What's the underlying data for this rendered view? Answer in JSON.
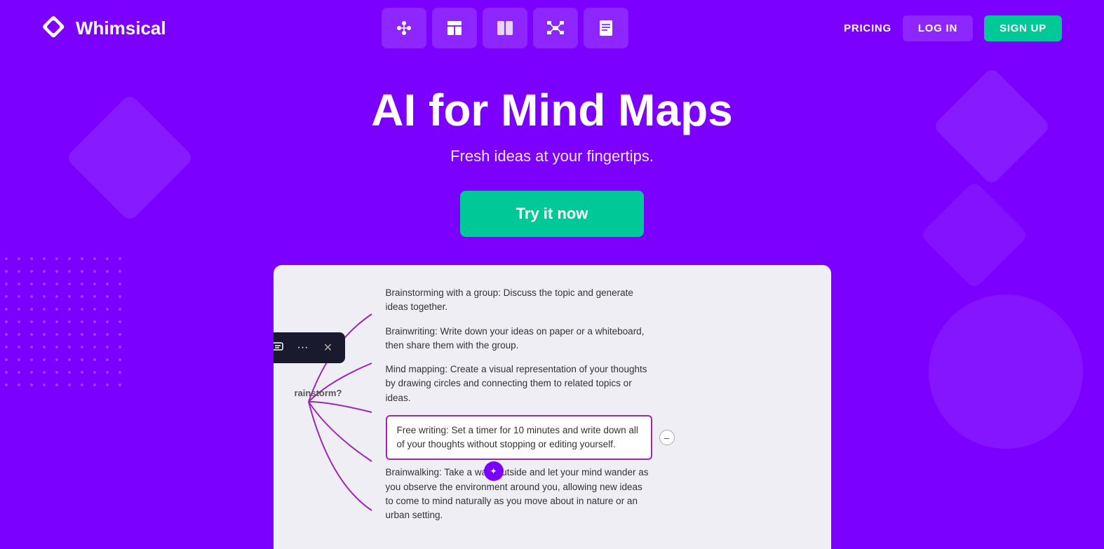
{
  "logo": {
    "text": "Whimsical"
  },
  "nav": {
    "tools": [
      {
        "id": "flowchart",
        "label": "Flowchart"
      },
      {
        "id": "wireframe",
        "label": "Wireframe"
      },
      {
        "id": "split",
        "label": "Split"
      },
      {
        "id": "mindmap",
        "label": "Mind Map"
      },
      {
        "id": "docs",
        "label": "Docs"
      }
    ],
    "pricing": "PRICING",
    "login": "LOG IN",
    "signup": "SIGN UP"
  },
  "hero": {
    "title": "AI for Mind Maps",
    "subtitle": "Fresh ideas at your fingertips.",
    "cta": "Try it now"
  },
  "preview": {
    "root_label": "rainstorm?",
    "nodes": [
      {
        "text": "Brainstorming with a group: Discuss the topic and generate ideas together.",
        "selected": false
      },
      {
        "text": "Brainwriting: Write down your ideas on paper or a whiteboard, then share them with the group.",
        "selected": false
      },
      {
        "text": "Mind mapping: Create a visual representation of your thoughts by drawing circles and connecting them to related topics or ideas.",
        "selected": false
      },
      {
        "text": "Free writing: Set a timer for 10 minutes and write down all of your thoughts without stopping or editing yourself.",
        "selected": true
      },
      {
        "text": "Brainwalking: Take a walk outside and let your mind wander as you observe the environment around you, allowing new ideas to come to mind naturally as you move about in nature or an urban setting.",
        "selected": false
      }
    ],
    "toolbar": {
      "ai_btn": "✦",
      "copy_btn": "⧉",
      "comment_btn": "☰",
      "more_btn": "···",
      "close_btn": "✕"
    }
  },
  "colors": {
    "brand_purple": "#7B00FF",
    "teal": "#00C896",
    "dark_nav": "#1a1a2e"
  }
}
